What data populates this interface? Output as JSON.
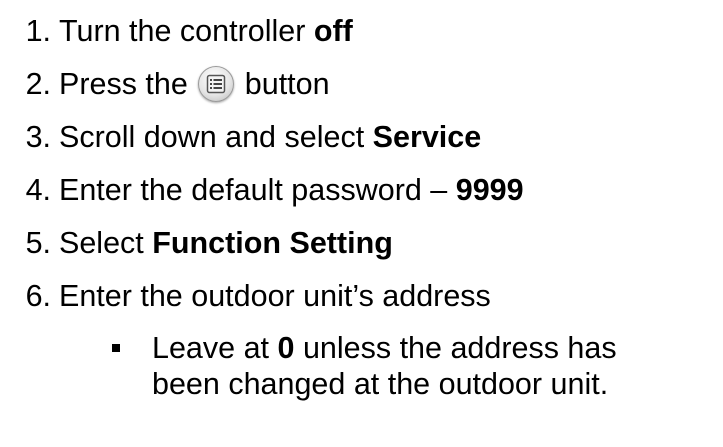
{
  "steps": [
    {
      "num": "1.",
      "text": "Turn the controller ",
      "bold": "off"
    },
    {
      "num": "2.",
      "before": "Press the ",
      "after": " button"
    },
    {
      "num": "3.",
      "text": "Scroll down and select ",
      "bold": "Service"
    },
    {
      "num": "4.",
      "text": "Enter the default password – ",
      "bold": "9999"
    },
    {
      "num": "5.",
      "text": "Select ",
      "bold": "Function Setting"
    },
    {
      "num": "6.",
      "text": "Enter the outdoor unit’s address"
    }
  ],
  "sub_bullet": {
    "before": "Leave at ",
    "bold": "0",
    "after": " unless the address has",
    "line2": "been changed at the outdoor unit."
  },
  "icons": {
    "menu_button": "menu-list-icon"
  }
}
